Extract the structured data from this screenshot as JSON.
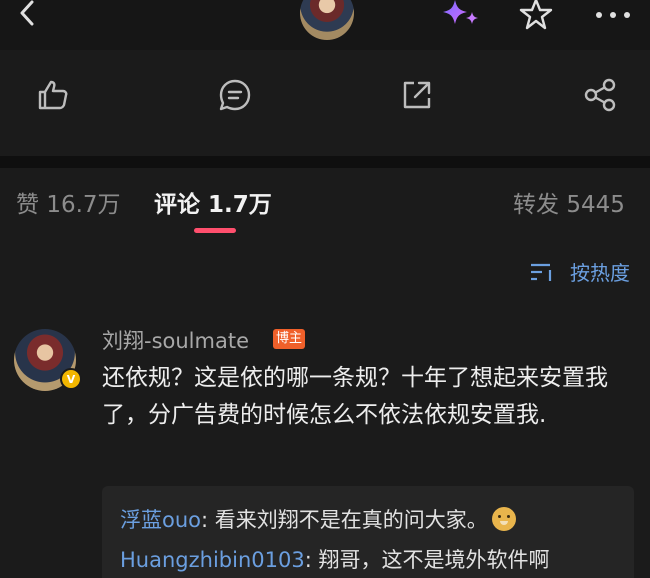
{
  "header": {
    "icons": [
      "back-arrow-icon",
      "avatar",
      "sparkle-icon",
      "star-icon",
      "more-icon"
    ]
  },
  "actions": {
    "icons": [
      "thumbs-up-icon",
      "comment-icon",
      "share-out-icon",
      "share-icon"
    ]
  },
  "tabs": [
    {
      "label": "赞",
      "count": "16.7万",
      "active": false
    },
    {
      "label": "评论",
      "count": "1.7万",
      "active": true
    },
    {
      "label": "转发",
      "count": "5445",
      "active": false
    }
  ],
  "sort": {
    "label": "按热度",
    "icon": "sort-icon"
  },
  "comment": {
    "username": "刘翔-soulmate",
    "badge": "博主",
    "verified_mark": "V",
    "text": "还依规？这是依的哪一条规？十年了想起来安置我了，分广告费的时候怎么不依法依规安置我.",
    "replies": [
      {
        "name": "浮蓝ouo",
        "text": ": 看来刘翔不是在真的问大家。",
        "emoji": "doge-emoji"
      },
      {
        "name": "Huangzhibin0103",
        "text": ": 翔哥，这不是境外软件啊"
      }
    ]
  },
  "colors": {
    "background": "#161616",
    "panel": "#1b1b1b",
    "accent_underline": "#ff4f6d",
    "link_blue": "#6b9fe0",
    "badge_orange": "#f0602a",
    "verified_gold": "#f2b600"
  }
}
